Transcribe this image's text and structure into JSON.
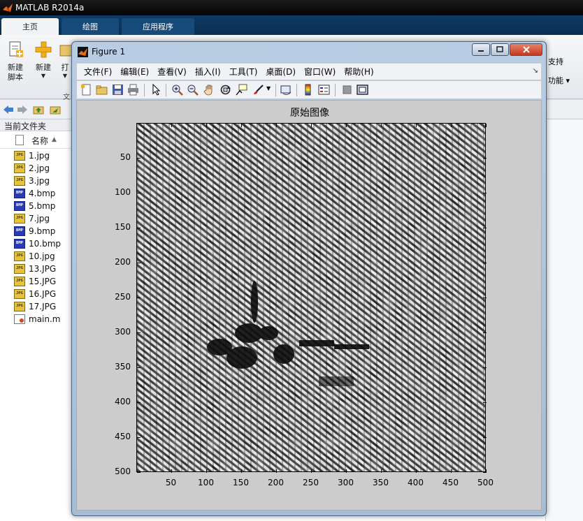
{
  "main_window": {
    "title": "MATLAB R2014a",
    "tabs": [
      {
        "label": "主页",
        "active": true
      },
      {
        "label": "绘图",
        "active": false
      },
      {
        "label": "应用程序",
        "active": false
      }
    ],
    "ribbon": {
      "buttons": [
        {
          "label": "新建\n脚本",
          "icon": "new-script-icon",
          "dropdown": false
        },
        {
          "label": "新建",
          "icon": "new-plus-icon",
          "dropdown": true
        },
        {
          "label": "打",
          "icon": "open-folder-icon",
          "dropdown": true
        }
      ],
      "group_label": "文",
      "right_partial_top": "支持",
      "right_partial_bottom": "功能"
    },
    "current_folder_label": "当前文件夹",
    "file_column_name": "名称",
    "files": [
      {
        "name": "1.jpg",
        "type": "jpg"
      },
      {
        "name": "2.jpg",
        "type": "jpg"
      },
      {
        "name": "3.jpg",
        "type": "jpg"
      },
      {
        "name": "4.bmp",
        "type": "bmp"
      },
      {
        "name": "5.bmp",
        "type": "bmp"
      },
      {
        "name": "7.jpg",
        "type": "jpg"
      },
      {
        "name": "9.bmp",
        "type": "bmp"
      },
      {
        "name": "10.bmp",
        "type": "bmp"
      },
      {
        "name": "10.jpg",
        "type": "jpg"
      },
      {
        "name": "13.JPG",
        "type": "jpg"
      },
      {
        "name": "15.JPG",
        "type": "jpg"
      },
      {
        "name": "16.JPG",
        "type": "jpg"
      },
      {
        "name": "17.JPG",
        "type": "jpg"
      },
      {
        "name": "main.m",
        "type": "m"
      }
    ],
    "file_icon_text": {
      "jpg": "JPG",
      "bmp": "BMP",
      "m": ""
    }
  },
  "figure": {
    "title": "Figure 1",
    "menus": [
      "文件(F)",
      "编辑(E)",
      "查看(V)",
      "插入(I)",
      "工具(T)",
      "桌面(D)",
      "窗口(W)",
      "帮助(H)"
    ],
    "toolbar_icons": [
      "new-figure-icon",
      "open-file-icon",
      "save-icon",
      "print-icon",
      "pointer-icon",
      "zoom-in-icon",
      "zoom-out-icon",
      "pan-hand-icon",
      "rotate-3d-icon",
      "data-cursor-icon",
      "brush-icon",
      "link-plot-icon",
      "colorbar-icon",
      "legend-icon",
      "hide-plot-tools-icon",
      "show-plot-tools-icon"
    ],
    "axes_title": "原始图像",
    "x_ticks": [
      50,
      100,
      150,
      200,
      250,
      300,
      350,
      400,
      450,
      500
    ],
    "y_ticks": [
      50,
      100,
      150,
      200,
      250,
      300,
      350,
      400,
      450,
      500
    ],
    "x_range": [
      0.5,
      500.5
    ],
    "y_range": [
      0.5,
      500.5
    ],
    "image_colormap": "gray"
  }
}
